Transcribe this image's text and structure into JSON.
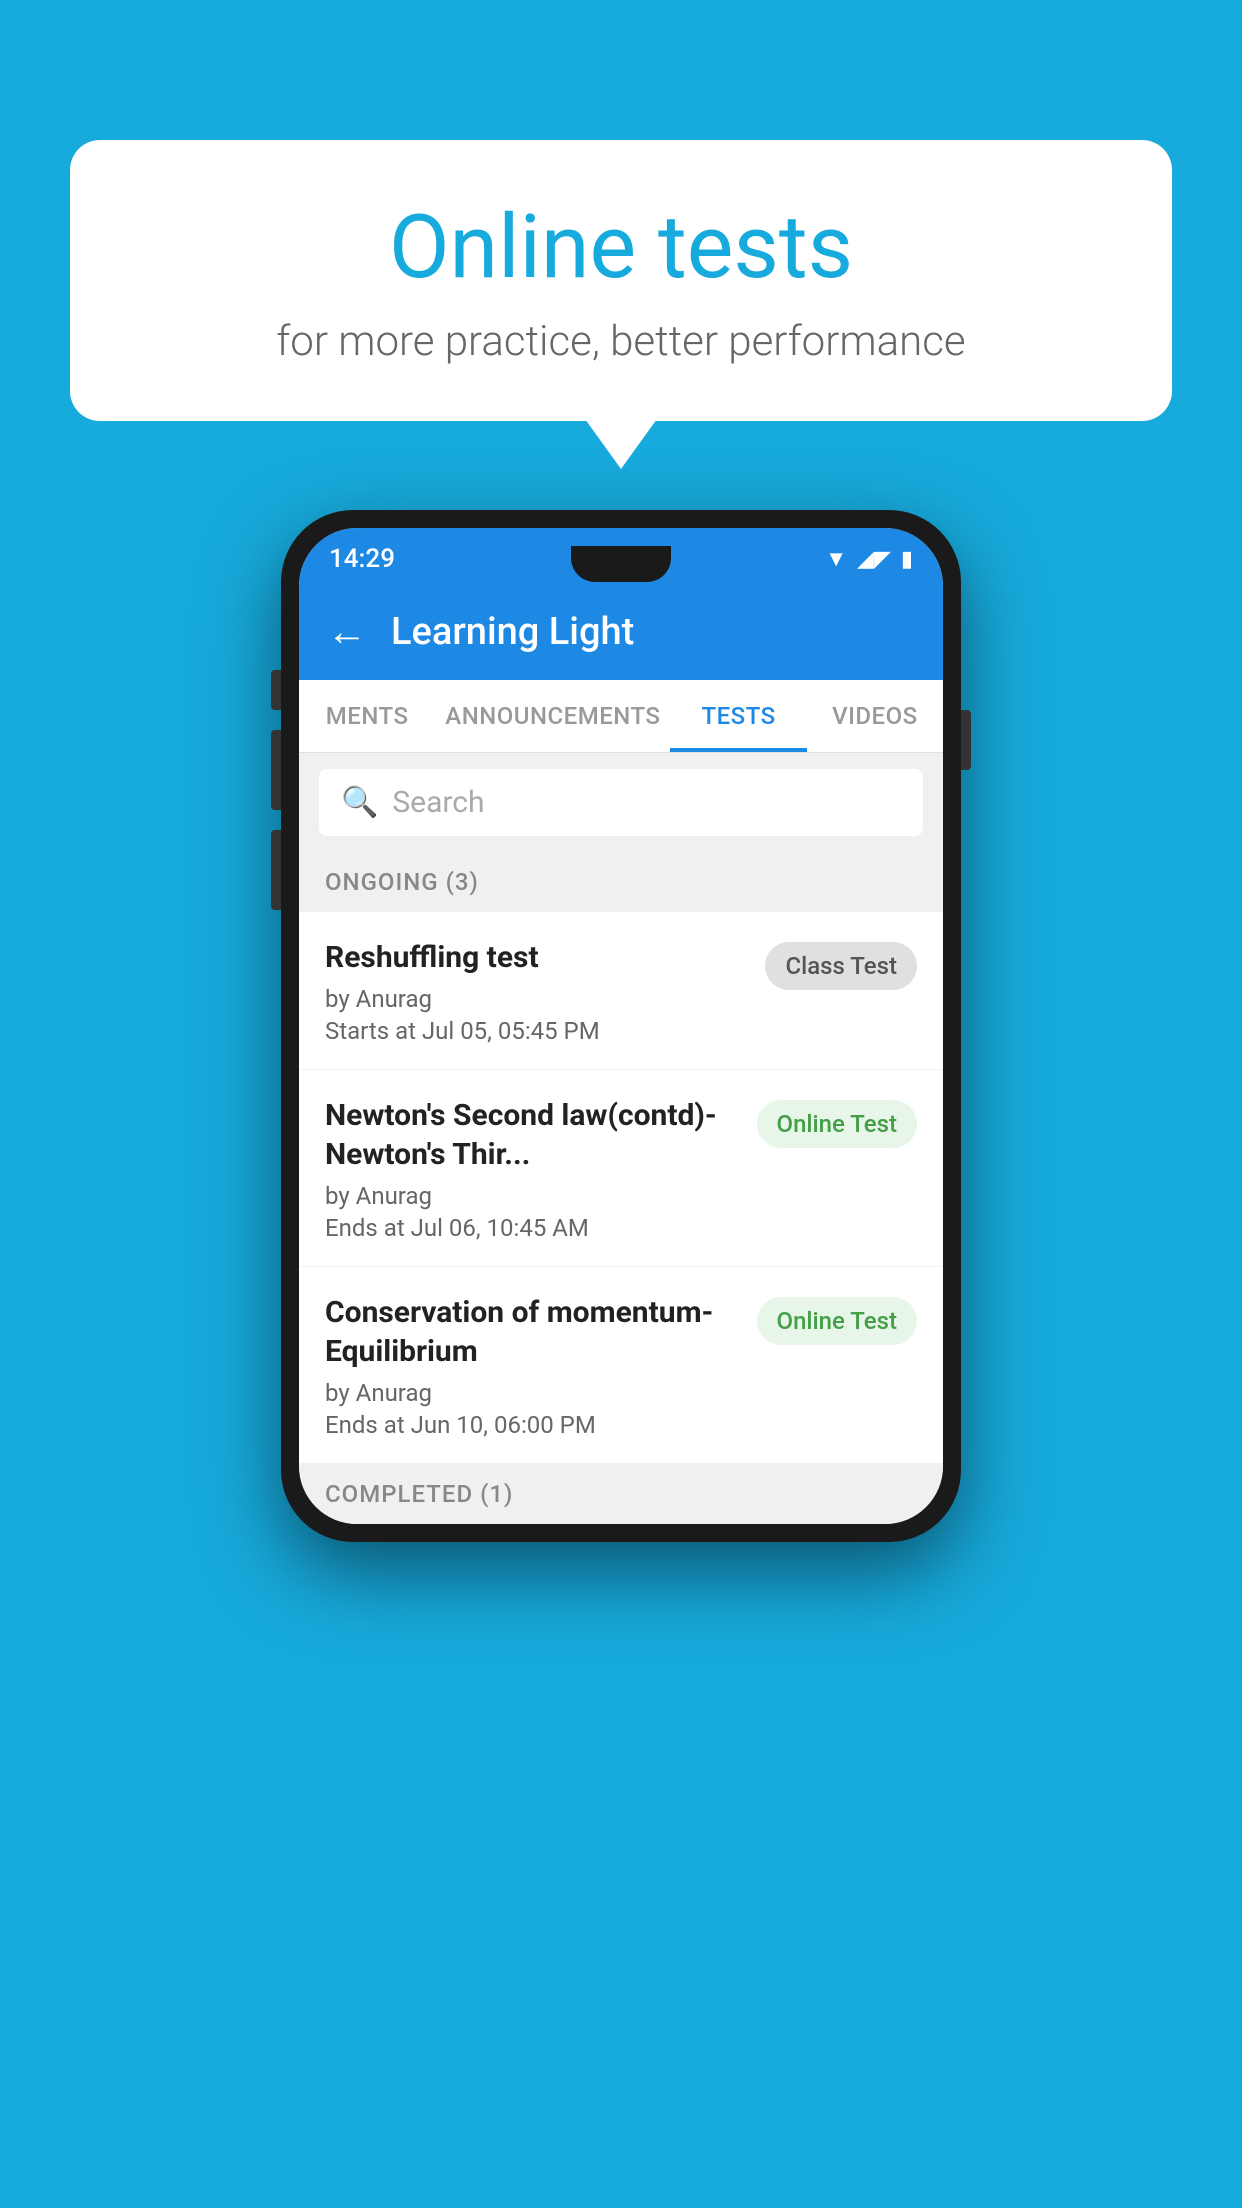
{
  "background": {
    "color": "#17AADC"
  },
  "speechBubble": {
    "title": "Online tests",
    "subtitle": "for more practice, better performance"
  },
  "statusBar": {
    "time": "14:29",
    "icons": [
      "wifi",
      "signal",
      "battery"
    ]
  },
  "appBar": {
    "backLabel": "←",
    "title": "Learning Light"
  },
  "tabs": [
    {
      "label": "MENTS",
      "active": false
    },
    {
      "label": "ANNOUNCEMENTS",
      "active": false
    },
    {
      "label": "TESTS",
      "active": true
    },
    {
      "label": "VIDEOS",
      "active": false
    }
  ],
  "search": {
    "placeholder": "Search",
    "iconLabel": "🔍"
  },
  "ongoingSection": {
    "label": "ONGOING (3)"
  },
  "tests": [
    {
      "title": "Reshuffling test",
      "author": "by Anurag",
      "time": "Starts at  Jul 05, 05:45 PM",
      "badge": "Class Test",
      "badgeType": "class"
    },
    {
      "title": "Newton's Second law(contd)-Newton's Thir...",
      "author": "by Anurag",
      "time": "Ends at  Jul 06, 10:45 AM",
      "badge": "Online Test",
      "badgeType": "online"
    },
    {
      "title": "Conservation of momentum-Equilibrium",
      "author": "by Anurag",
      "time": "Ends at  Jun 10, 06:00 PM",
      "badge": "Online Test",
      "badgeType": "online"
    }
  ],
  "completedSection": {
    "label": "COMPLETED (1)"
  }
}
